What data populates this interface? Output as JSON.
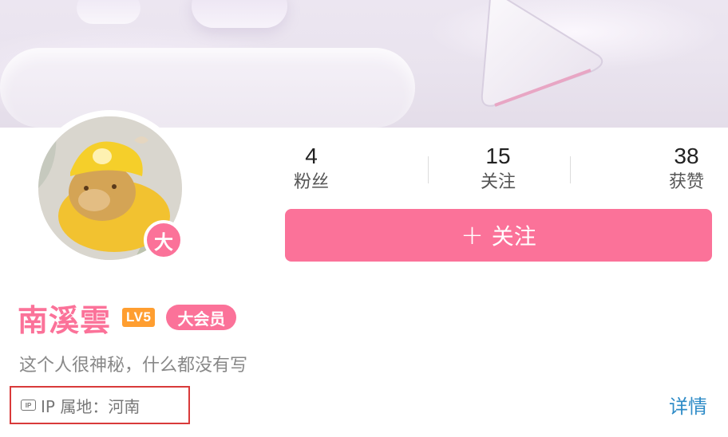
{
  "stats": {
    "fans": {
      "count": "4",
      "label": "粉丝"
    },
    "following": {
      "count": "15",
      "label": "关注"
    },
    "likes": {
      "count": "38",
      "label": "获赞"
    }
  },
  "follow_button": {
    "icon": "+",
    "label": "关注"
  },
  "profile": {
    "username": "南溪雲",
    "level_badge": "LV5",
    "vip_badge_avatar": "大",
    "vip_tag": "大会员",
    "bio": "这个人很神秘，什么都没有写"
  },
  "ip": {
    "icon": "IP",
    "text": "IP 属地：河南"
  },
  "details_link": "详情",
  "colors": {
    "accent": "#fb7299",
    "link": "#2e8bc7",
    "level": "#ff9e30",
    "highlight_box": "#d93a3a"
  }
}
